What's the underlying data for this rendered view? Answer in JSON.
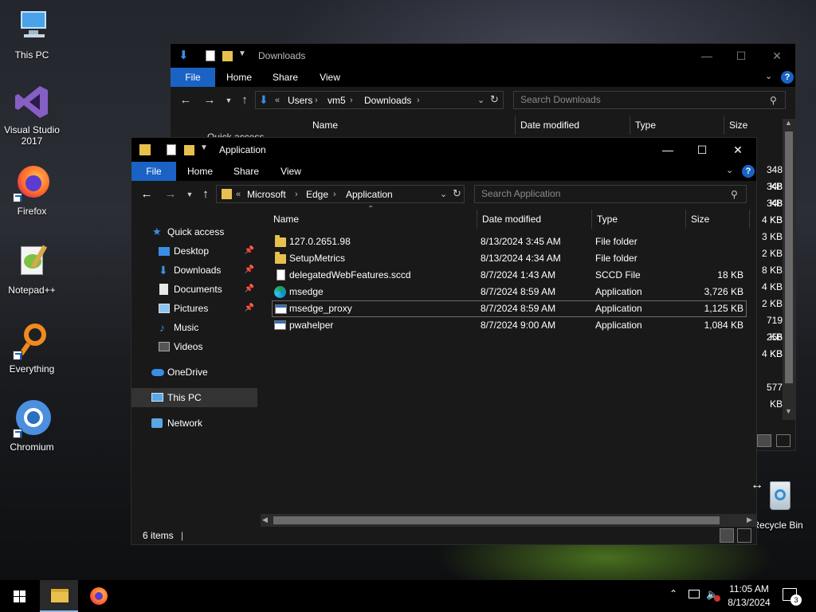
{
  "desktop": {
    "icons": [
      {
        "label": "This PC"
      },
      {
        "label": "Visual Studio 2017"
      },
      {
        "label": "Firefox"
      },
      {
        "label": "Notepad++"
      },
      {
        "label": "Everything"
      },
      {
        "label": "Chromium"
      },
      {
        "label": "Recycle Bin"
      }
    ]
  },
  "back_window": {
    "title": "Downloads",
    "tabs": [
      "File",
      "Home",
      "Share",
      "View"
    ],
    "breadcrumb": [
      "Users",
      "vm5",
      "Downloads"
    ],
    "search_placeholder": "Search Downloads",
    "columns": [
      "Name",
      "Date modified",
      "Type",
      "Size"
    ],
    "nav_partial": "Quick access",
    "sizes_partial": [
      "348 KB",
      "348 KB",
      "348 KB",
      "4 KB",
      "3 KB",
      "2 KB",
      "8 KB",
      "4 KB",
      "2 KB",
      "719 KB",
      "256 KB",
      "4 KB",
      "577 KB"
    ]
  },
  "front_window": {
    "title": "Application",
    "tabs": [
      "File",
      "Home",
      "Share",
      "View"
    ],
    "breadcrumb": [
      "Microsoft",
      "Edge",
      "Application"
    ],
    "breadcrumb_overflow": "«",
    "search_placeholder": "Search Application",
    "columns": [
      "Name",
      "Date modified",
      "Type",
      "Size"
    ],
    "nav": [
      {
        "label": "Quick access",
        "icon": "star-icon"
      },
      {
        "label": "Desktop",
        "icon": "desktop-folder-icon",
        "pinned": true
      },
      {
        "label": "Downloads",
        "icon": "download-arrow-icon",
        "pinned": true
      },
      {
        "label": "Documents",
        "icon": "documents-icon",
        "pinned": true
      },
      {
        "label": "Pictures",
        "icon": "pictures-icon",
        "pinned": true
      },
      {
        "label": "Music",
        "icon": "music-note-icon"
      },
      {
        "label": "Videos",
        "icon": "videos-icon"
      },
      {
        "label": "OneDrive",
        "icon": "cloud-icon"
      },
      {
        "label": "This PC",
        "icon": "computer-icon",
        "selected": true
      },
      {
        "label": "Network",
        "icon": "network-icon"
      }
    ],
    "files": [
      {
        "name": "127.0.2651.98",
        "date": "8/13/2024 3:45 AM",
        "type": "File folder",
        "size": "",
        "icon": "folder-icon"
      },
      {
        "name": "SetupMetrics",
        "date": "8/13/2024 4:34 AM",
        "type": "File folder",
        "size": "",
        "icon": "folder-icon"
      },
      {
        "name": "delegatedWebFeatures.sccd",
        "date": "8/7/2024 1:43 AM",
        "type": "SCCD File",
        "size": "18 KB",
        "icon": "file-icon"
      },
      {
        "name": "msedge",
        "date": "8/7/2024 8:59 AM",
        "type": "Application",
        "size": "3,726 KB",
        "icon": "edge-icon"
      },
      {
        "name": "msedge_proxy",
        "date": "8/7/2024 8:59 AM",
        "type": "Application",
        "size": "1,125 KB",
        "icon": "app-icon",
        "selected": true
      },
      {
        "name": "pwahelper",
        "date": "8/7/2024 9:00 AM",
        "type": "Application",
        "size": "1,084 KB",
        "icon": "app-icon"
      }
    ],
    "status": "6 items"
  },
  "taskbar": {
    "time": "11:05 AM",
    "date": "8/13/2024",
    "notification_count": "3"
  },
  "colors": {
    "accent": "#1a63c4",
    "window_bg": "#191919",
    "titlebar": "#000000"
  }
}
